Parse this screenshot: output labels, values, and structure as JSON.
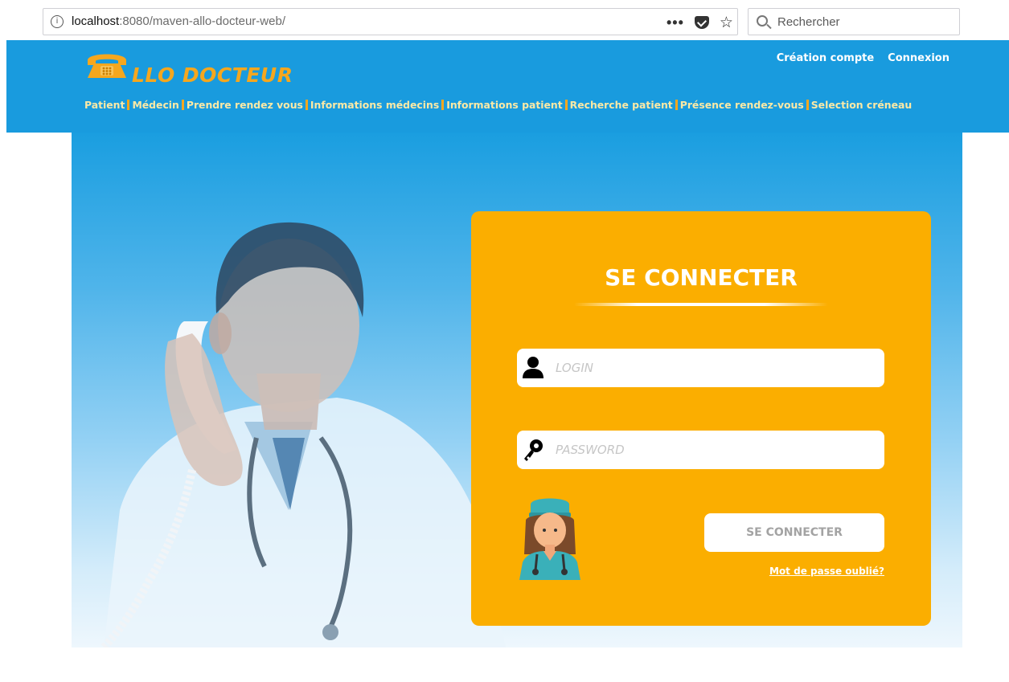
{
  "browser": {
    "url_host": "localhost",
    "url_path": ":8080/maven-allo-docteur-web/",
    "info_glyph": "i",
    "menu_glyph": "•••",
    "bookmark_glyph": "☆",
    "search_placeholder": "Rechercher",
    "icons": [
      "info-icon",
      "more-actions-icon",
      "pocket-icon",
      "bookmark-star-icon",
      "search-icon"
    ]
  },
  "header": {
    "logo_text": "LLO DOCTEUR",
    "account_links": [
      {
        "label": "Création compte"
      },
      {
        "label": "Connexion"
      }
    ],
    "nav": [
      {
        "label": "Patient"
      },
      {
        "label": "Médecin"
      },
      {
        "label": "Prendre rendez vous"
      },
      {
        "label": "Informations médecins"
      },
      {
        "label": "Informations patient"
      },
      {
        "label": "Recherche patient"
      },
      {
        "label": "Présence rendez-vous"
      },
      {
        "label": "Selection créneau"
      }
    ],
    "background_color": "#199bde",
    "accent_color": "#f5a71e"
  },
  "login": {
    "title": "SE CONNECTER",
    "login_placeholder": "LOGIN",
    "password_placeholder": "PASSWORD",
    "submit_label": "SE CONNECTER",
    "forgot_label": "Mot de passe oublié?",
    "card_color": "#fbae00",
    "icons": [
      "user-icon",
      "key-icon",
      "nurse-avatar-icon"
    ]
  }
}
